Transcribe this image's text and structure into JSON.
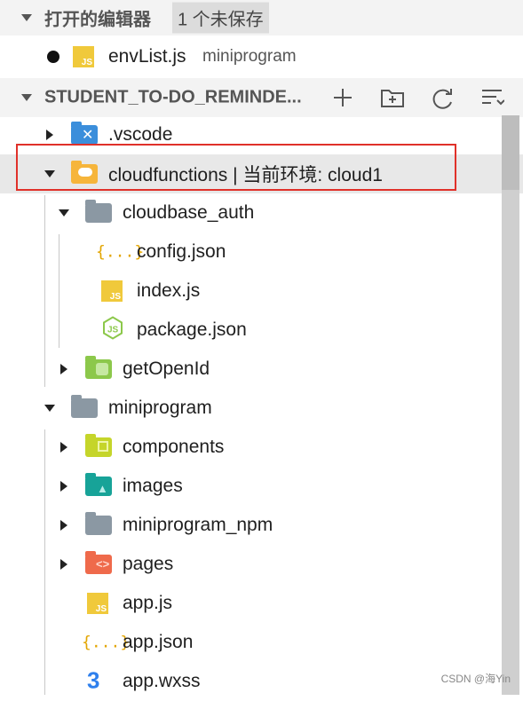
{
  "open_editors": {
    "title": "打开的编辑器",
    "badge": "1 个未保存",
    "files": [
      {
        "name": "envList.js",
        "path": "miniprogram",
        "icon": "js-file-icon",
        "unsaved": true
      }
    ]
  },
  "explorer": {
    "title": "STUDENT_TO-DO_REMINDE...",
    "tools": [
      "new-file-icon",
      "new-folder-icon",
      "refresh-icon",
      "collapse-all-icon"
    ],
    "tree": [
      {
        "label": ".vscode",
        "kind": "folder",
        "expanded": false,
        "icon": "vscode-folder-icon",
        "color": "#3b8edb"
      },
      {
        "label": "cloudfunctions | 当前环境: cloud1",
        "kind": "folder",
        "expanded": true,
        "icon": "cloud-folder-icon",
        "color": "#f6b53b"
      },
      {
        "label": "cloudbase_auth",
        "kind": "folder",
        "expanded": true,
        "icon": "folder-icon",
        "color": "#8b98a3"
      },
      {
        "label": "config.json",
        "kind": "file",
        "icon": "json-file-icon",
        "color": "#e3a500"
      },
      {
        "label": "index.js",
        "kind": "file",
        "icon": "js-file-icon",
        "color": "#f0c93b"
      },
      {
        "label": "package.json",
        "kind": "file",
        "icon": "nodejs-file-icon",
        "color": "#8cc84b"
      },
      {
        "label": "getOpenId",
        "kind": "folder",
        "expanded": false,
        "icon": "function-folder-icon",
        "color": "#8cc84b"
      },
      {
        "label": "miniprogram",
        "kind": "folder",
        "expanded": true,
        "icon": "folder-icon",
        "color": "#8b98a3"
      },
      {
        "label": "components",
        "kind": "folder",
        "expanded": false,
        "icon": "components-folder-icon",
        "color": "#c5d52a"
      },
      {
        "label": "images",
        "kind": "folder",
        "expanded": false,
        "icon": "images-folder-icon",
        "color": "#17a398"
      },
      {
        "label": "miniprogram_npm",
        "kind": "folder",
        "expanded": false,
        "icon": "folder-icon",
        "color": "#8b98a3"
      },
      {
        "label": "pages",
        "kind": "folder",
        "expanded": false,
        "icon": "pages-folder-icon",
        "color": "#ef6a4b"
      },
      {
        "label": "app.js",
        "kind": "file",
        "icon": "js-file-icon",
        "color": "#f0c93b"
      },
      {
        "label": "app.json",
        "kind": "file",
        "icon": "json-file-icon",
        "color": "#e3a500"
      },
      {
        "label": "app.wxss",
        "kind": "file",
        "icon": "css-file-icon",
        "color": "#2f80ed"
      }
    ]
  },
  "watermark": "CSDN @海Yin"
}
